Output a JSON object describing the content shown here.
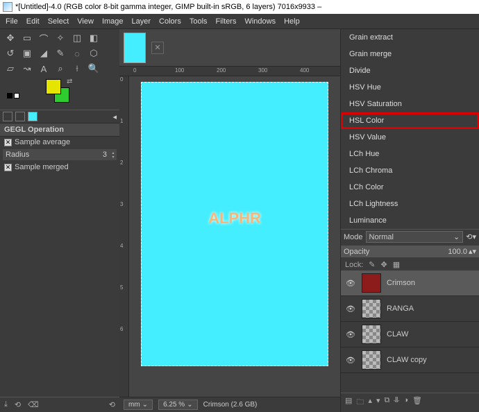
{
  "title": "*[Untitled]-4.0 (RGB color 8-bit gamma integer, GIMP built-in sRGB, 6 layers) 7016x9933 –",
  "menus": [
    "File",
    "Edit",
    "Select",
    "View",
    "Image",
    "Layer",
    "Colors",
    "Tools",
    "Filters",
    "Windows",
    "Help"
  ],
  "gegl": {
    "title": "GEGL Operation",
    "sample_average": "Sample average",
    "radius_label": "Radius",
    "radius_value": "3",
    "sample_merged": "Sample merged"
  },
  "ruler_h": [
    "0",
    "100",
    "200",
    "300",
    "400"
  ],
  "ruler_v": [
    "0",
    "1",
    "2",
    "3",
    "4",
    "5",
    "6"
  ],
  "canvas_text": "ALPHR",
  "status": {
    "unit": "mm",
    "zoom": "6.25 %",
    "layer_info": "Crimson (2.6 GB)"
  },
  "blend_modes": [
    "Grain extract",
    "Grain merge",
    "Divide",
    "HSV Hue",
    "HSV Saturation",
    "HSL Color",
    "HSV Value",
    "LCh Hue",
    "LCh Chroma",
    "LCh Color",
    "LCh Lightness",
    "Luminance"
  ],
  "blend_highlight_index": 5,
  "mode": {
    "label": "Mode",
    "value": "Normal"
  },
  "opacity": {
    "label": "Opacity",
    "value": "100.0"
  },
  "lock_label": "Lock:",
  "layers": [
    {
      "name": "Crimson",
      "active": true,
      "thumb": "crimson"
    },
    {
      "name": "RANGA",
      "active": false,
      "thumb": "checker"
    },
    {
      "name": "CLAW",
      "active": false,
      "thumb": "checker"
    },
    {
      "name": "CLAW copy",
      "active": false,
      "thumb": "checker"
    }
  ],
  "colors": {
    "fg": "#e5e500",
    "bg": "#2ecc2e"
  }
}
